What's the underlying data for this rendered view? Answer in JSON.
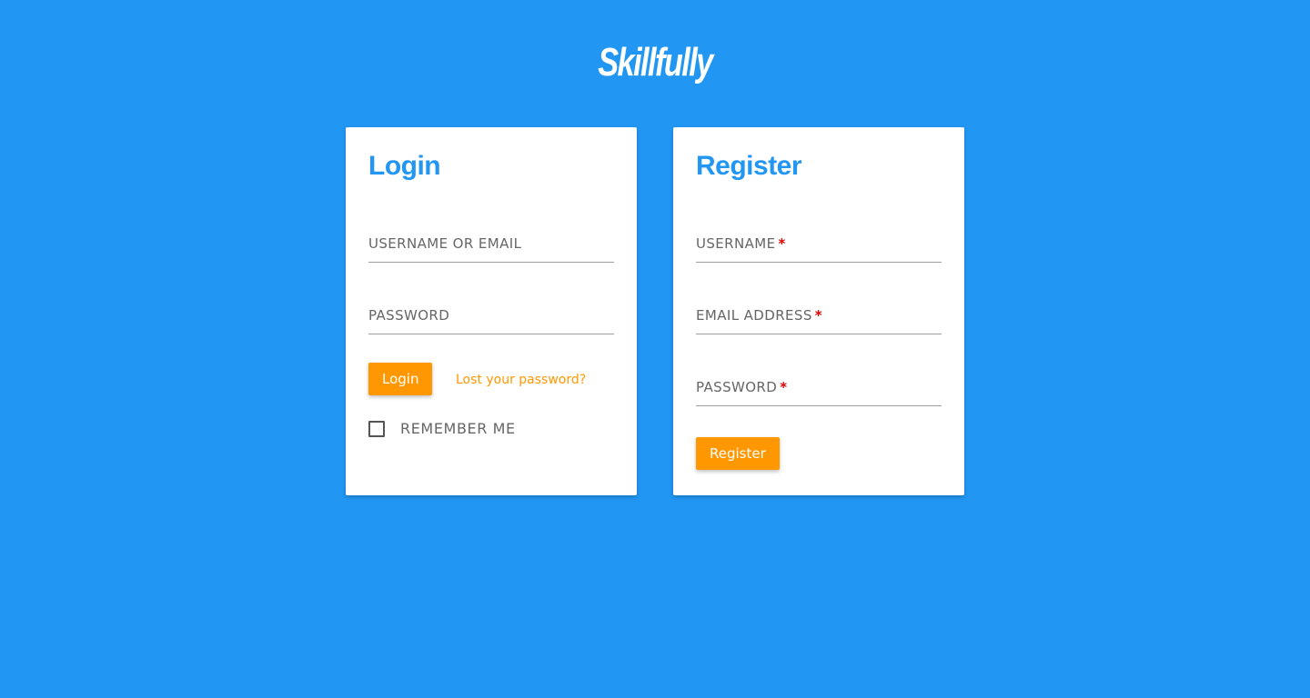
{
  "brand": {
    "logo_text": "Skillfully"
  },
  "login": {
    "title": "Login",
    "username_label": "USERNAME OR EMAIL",
    "password_label": "PASSWORD",
    "submit_label": "Login",
    "lost_password_link": "Lost your password?",
    "remember_label": "REMEMBER ME",
    "remember_checked": false
  },
  "register": {
    "title": "Register",
    "username_label": "USERNAME",
    "email_label": "EMAIL ADDRESS",
    "password_label": "PASSWORD",
    "required_mark": "*",
    "submit_label": "Register"
  },
  "colors": {
    "background": "#2196f3",
    "accent": "#ff9800",
    "title": "#2196f3",
    "required": "#e00000"
  }
}
